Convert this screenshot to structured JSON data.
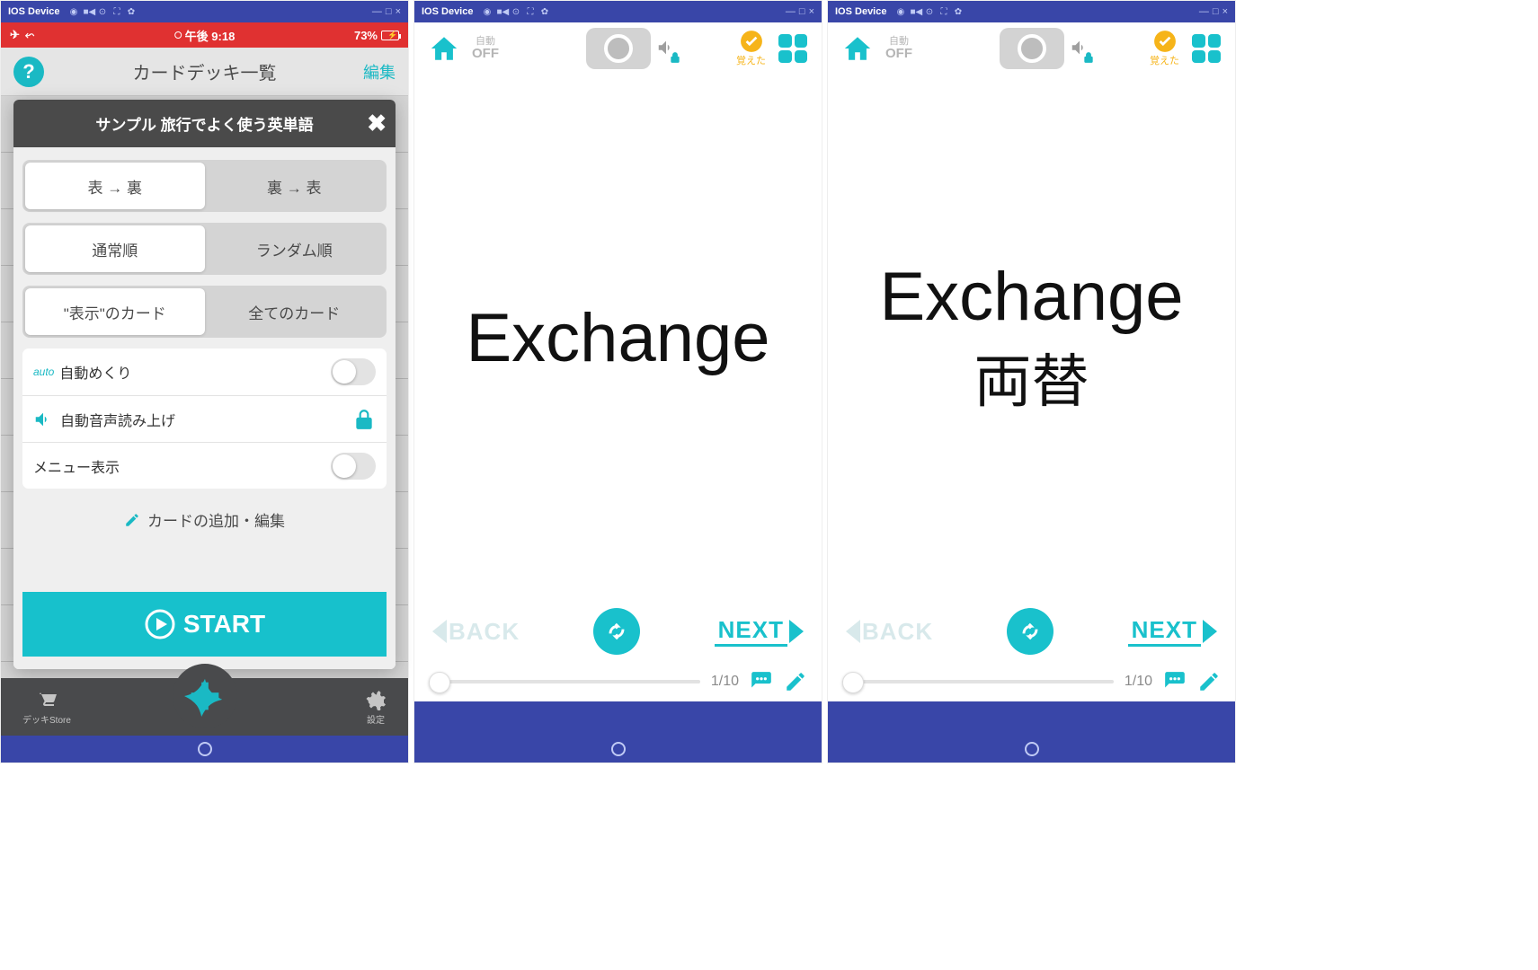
{
  "emulator": {
    "title": "IOS Device",
    "minimize": "—",
    "box": "□",
    "close": "×"
  },
  "screen1": {
    "status": {
      "time": "午後 9:18",
      "battery": "73%"
    },
    "nav": {
      "title": "カードデッキ一覧",
      "edit": "編集"
    },
    "modal": {
      "title": "サンプル 旅行でよく使う英単語",
      "seg1a": "表 → 裏",
      "seg1b": "裏 → 表",
      "seg2a": "通常順",
      "seg2b": "ランダム順",
      "seg3a": "\"表示\"のカード",
      "seg3b": "全てのカード",
      "auto_label": "auto",
      "auto_flip": "自動めくり",
      "auto_voice": "自動音声読み上げ",
      "menu_display": "メニュー表示",
      "edit_cards": "カードの追加・編集",
      "start": "START"
    },
    "bottom": {
      "store": "デッキStore",
      "settings": "設定"
    }
  },
  "screen2": {
    "auto_text1": "自動",
    "auto_text2": "OFF",
    "learned": "覚えた",
    "word": "Exchange",
    "back": "BACK",
    "next": "NEXT",
    "progress": "1/10"
  },
  "screen3": {
    "auto_text1": "自動",
    "auto_text2": "OFF",
    "learned": "覚えた",
    "word": "Exchange",
    "translation": "両替",
    "back": "BACK",
    "next": "NEXT",
    "progress": "1/10"
  }
}
